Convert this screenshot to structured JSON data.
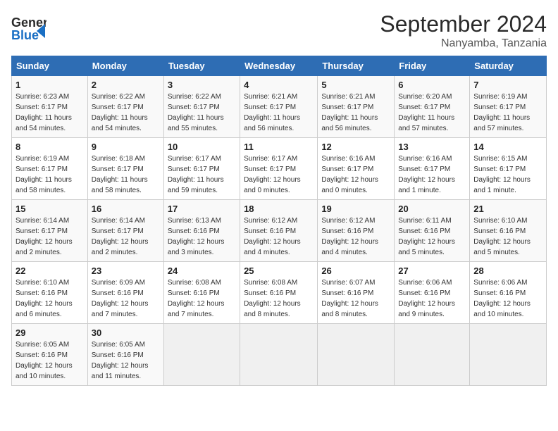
{
  "header": {
    "logo_line1": "General",
    "logo_line2": "Blue",
    "month": "September 2024",
    "location": "Nanyamba, Tanzania"
  },
  "days_of_week": [
    "Sunday",
    "Monday",
    "Tuesday",
    "Wednesday",
    "Thursday",
    "Friday",
    "Saturday"
  ],
  "weeks": [
    [
      {
        "day": "1",
        "sunrise": "6:23 AM",
        "sunset": "6:17 PM",
        "daylight": "11 hours and 54 minutes."
      },
      {
        "day": "2",
        "sunrise": "6:22 AM",
        "sunset": "6:17 PM",
        "daylight": "11 hours and 54 minutes."
      },
      {
        "day": "3",
        "sunrise": "6:22 AM",
        "sunset": "6:17 PM",
        "daylight": "11 hours and 55 minutes."
      },
      {
        "day": "4",
        "sunrise": "6:21 AM",
        "sunset": "6:17 PM",
        "daylight": "11 hours and 56 minutes."
      },
      {
        "day": "5",
        "sunrise": "6:21 AM",
        "sunset": "6:17 PM",
        "daylight": "11 hours and 56 minutes."
      },
      {
        "day": "6",
        "sunrise": "6:20 AM",
        "sunset": "6:17 PM",
        "daylight": "11 hours and 57 minutes."
      },
      {
        "day": "7",
        "sunrise": "6:19 AM",
        "sunset": "6:17 PM",
        "daylight": "11 hours and 57 minutes."
      }
    ],
    [
      {
        "day": "8",
        "sunrise": "6:19 AM",
        "sunset": "6:17 PM",
        "daylight": "11 hours and 58 minutes."
      },
      {
        "day": "9",
        "sunrise": "6:18 AM",
        "sunset": "6:17 PM",
        "daylight": "11 hours and 58 minutes."
      },
      {
        "day": "10",
        "sunrise": "6:17 AM",
        "sunset": "6:17 PM",
        "daylight": "11 hours and 59 minutes."
      },
      {
        "day": "11",
        "sunrise": "6:17 AM",
        "sunset": "6:17 PM",
        "daylight": "12 hours and 0 minutes."
      },
      {
        "day": "12",
        "sunrise": "6:16 AM",
        "sunset": "6:17 PM",
        "daylight": "12 hours and 0 minutes."
      },
      {
        "day": "13",
        "sunrise": "6:16 AM",
        "sunset": "6:17 PM",
        "daylight": "12 hours and 1 minute."
      },
      {
        "day": "14",
        "sunrise": "6:15 AM",
        "sunset": "6:17 PM",
        "daylight": "12 hours and 1 minute."
      }
    ],
    [
      {
        "day": "15",
        "sunrise": "6:14 AM",
        "sunset": "6:17 PM",
        "daylight": "12 hours and 2 minutes."
      },
      {
        "day": "16",
        "sunrise": "6:14 AM",
        "sunset": "6:17 PM",
        "daylight": "12 hours and 2 minutes."
      },
      {
        "day": "17",
        "sunrise": "6:13 AM",
        "sunset": "6:16 PM",
        "daylight": "12 hours and 3 minutes."
      },
      {
        "day": "18",
        "sunrise": "6:12 AM",
        "sunset": "6:16 PM",
        "daylight": "12 hours and 4 minutes."
      },
      {
        "day": "19",
        "sunrise": "6:12 AM",
        "sunset": "6:16 PM",
        "daylight": "12 hours and 4 minutes."
      },
      {
        "day": "20",
        "sunrise": "6:11 AM",
        "sunset": "6:16 PM",
        "daylight": "12 hours and 5 minutes."
      },
      {
        "day": "21",
        "sunrise": "6:10 AM",
        "sunset": "6:16 PM",
        "daylight": "12 hours and 5 minutes."
      }
    ],
    [
      {
        "day": "22",
        "sunrise": "6:10 AM",
        "sunset": "6:16 PM",
        "daylight": "12 hours and 6 minutes."
      },
      {
        "day": "23",
        "sunrise": "6:09 AM",
        "sunset": "6:16 PM",
        "daylight": "12 hours and 7 minutes."
      },
      {
        "day": "24",
        "sunrise": "6:08 AM",
        "sunset": "6:16 PM",
        "daylight": "12 hours and 7 minutes."
      },
      {
        "day": "25",
        "sunrise": "6:08 AM",
        "sunset": "6:16 PM",
        "daylight": "12 hours and 8 minutes."
      },
      {
        "day": "26",
        "sunrise": "6:07 AM",
        "sunset": "6:16 PM",
        "daylight": "12 hours and 8 minutes."
      },
      {
        "day": "27",
        "sunrise": "6:06 AM",
        "sunset": "6:16 PM",
        "daylight": "12 hours and 9 minutes."
      },
      {
        "day": "28",
        "sunrise": "6:06 AM",
        "sunset": "6:16 PM",
        "daylight": "12 hours and 10 minutes."
      }
    ],
    [
      {
        "day": "29",
        "sunrise": "6:05 AM",
        "sunset": "6:16 PM",
        "daylight": "12 hours and 10 minutes."
      },
      {
        "day": "30",
        "sunrise": "6:05 AM",
        "sunset": "6:16 PM",
        "daylight": "12 hours and 11 minutes."
      },
      null,
      null,
      null,
      null,
      null
    ]
  ],
  "labels": {
    "sunrise": "Sunrise:",
    "sunset": "Sunset:",
    "daylight": "Daylight:"
  }
}
